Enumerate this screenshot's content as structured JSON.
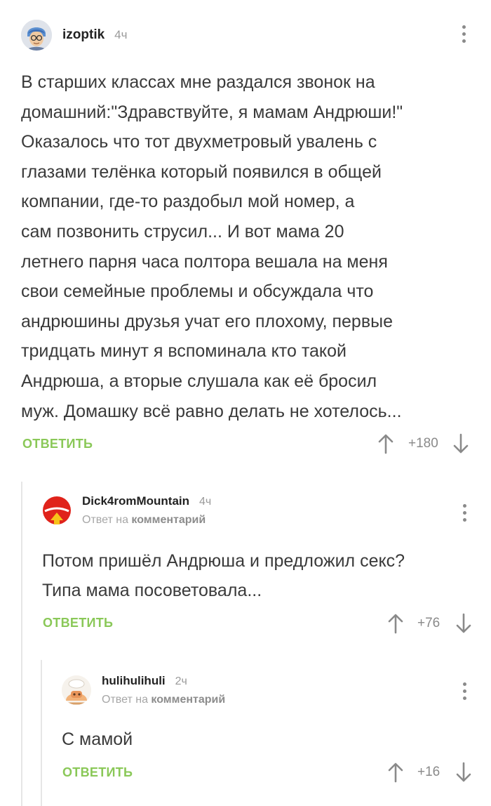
{
  "comments": [
    {
      "author": "izoptik",
      "time": "4ч",
      "reply_prefix": "",
      "reply_target": "",
      "text_lines": [
        "В старших классах мне раздался звонок на",
        "домашний:\"Здравствуйте, я мамам Андрюши!\"",
        "Оказалось что тот двухметровый увалень с",
        "глазами телёнка который появился в общей",
        "компании, где-то раздобыл мой номер, а",
        "сам позвонить струсил... И вот мама 20",
        "летнего парня часа полтора вешала на меня",
        "свои семейные проблемы и обсуждала что",
        "андрюшины друзья учат его плохому, первые",
        "тридцать минут я вспоминала кто такой",
        "Андрюша, а вторые слушала как её бросил",
        "муж. Домашку всё равно делать не хотелось..."
      ],
      "reply_label": "ОТВЕТИТЬ",
      "score": "+180",
      "avatar_icon": "man-with-glasses-avatar"
    },
    {
      "author": "Dick4romMountain",
      "time": "4ч",
      "reply_prefix": "Ответ на",
      "reply_target": "комментарий",
      "text_lines": [
        "Потом пришёл Андрюша и предложил секс?",
        "Типа мама посоветовала..."
      ],
      "reply_label": "ОТВЕТИТЬ",
      "score": "+76",
      "avatar_icon": "red-circle-avatar"
    },
    {
      "author": "hulihulihuli",
      "time": "2ч",
      "reply_prefix": "Ответ на",
      "reply_target": "комментарий",
      "text_lines": [
        "С мамой"
      ],
      "reply_label": "ОТВЕТИТЬ",
      "score": "+16",
      "avatar_icon": "cartoon-chef-avatar"
    }
  ],
  "colors": {
    "accent_green": "#8ac858",
    "thread_line": "#e6e6e6",
    "text": "#3a3a3a",
    "muted": "#9a9a9a"
  }
}
